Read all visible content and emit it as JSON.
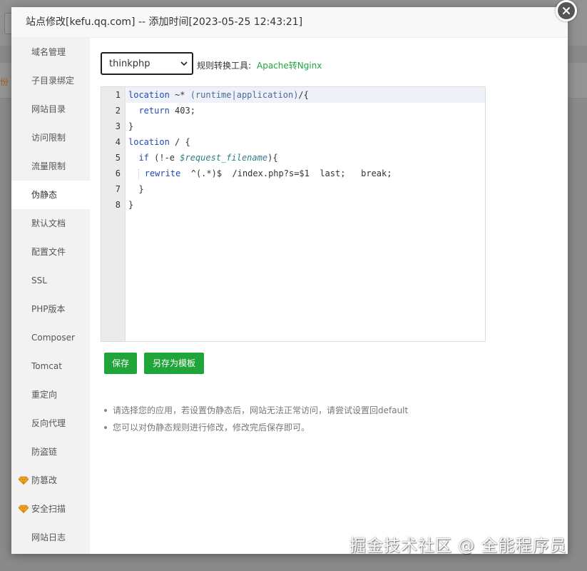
{
  "background": {
    "left_text": "份"
  },
  "dialog": {
    "title": "站点修改[kefu.qq.com] -- 添加时间[2023-05-25 12:43:21]"
  },
  "sidebar": {
    "items": [
      {
        "label": "域名管理",
        "active": false,
        "premium": false
      },
      {
        "label": "子目录绑定",
        "active": false,
        "premium": false
      },
      {
        "label": "网站目录",
        "active": false,
        "premium": false
      },
      {
        "label": "访问限制",
        "active": false,
        "premium": false
      },
      {
        "label": "流量限制",
        "active": false,
        "premium": false
      },
      {
        "label": "伪静态",
        "active": true,
        "premium": false
      },
      {
        "label": "默认文档",
        "active": false,
        "premium": false
      },
      {
        "label": "配置文件",
        "active": false,
        "premium": false
      },
      {
        "label": "SSL",
        "active": false,
        "premium": false
      },
      {
        "label": "PHP版本",
        "active": false,
        "premium": false
      },
      {
        "label": "Composer",
        "active": false,
        "premium": false
      },
      {
        "label": "Tomcat",
        "active": false,
        "premium": false
      },
      {
        "label": "重定向",
        "active": false,
        "premium": false
      },
      {
        "label": "反向代理",
        "active": false,
        "premium": false
      },
      {
        "label": "防盗链",
        "active": false,
        "premium": false
      },
      {
        "label": "防篡改",
        "active": false,
        "premium": true
      },
      {
        "label": "安全扫描",
        "active": false,
        "premium": true
      },
      {
        "label": "网站日志",
        "active": false,
        "premium": false
      }
    ]
  },
  "rewrite": {
    "selected_app": "thinkphp",
    "tool_label": "规则转换工具:",
    "tool_link": "Apache转Nginx"
  },
  "editor": {
    "line_numbers": [
      "1",
      "2",
      "3",
      "4",
      "5",
      "6",
      "7",
      "8"
    ],
    "current_line": 1
  },
  "buttons": {
    "save": "保存",
    "save_template": "另存为模板"
  },
  "tips": [
    "请选择您的应用，若设置伪静态后，网站无法正常访问，请尝试设置回default",
    "您可以对伪静态规则进行修改，修改完后保存即可。"
  ],
  "watermark": "掘金技术社区 @ 全能程序员",
  "colors": {
    "accent_green": "#20a53a",
    "sidebar_bg": "#f2f2f2",
    "keyword_blue": "#1f4bb2"
  },
  "icons": {
    "close": "close-icon",
    "premium": "diamond-icon",
    "select": "chevron-down-icon"
  }
}
